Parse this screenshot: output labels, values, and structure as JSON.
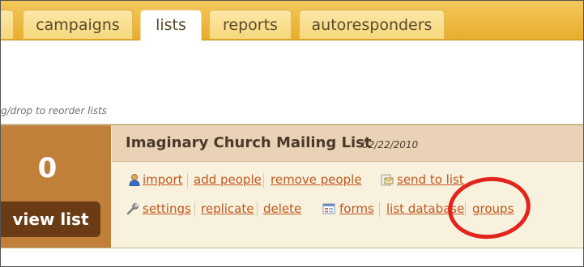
{
  "tabs": [
    {
      "label": "campaigns"
    },
    {
      "label": "lists"
    },
    {
      "label": "reports"
    },
    {
      "label": "autoresponders"
    }
  ],
  "hint": "g/drop to reorder lists",
  "list": {
    "count": "0",
    "view_label": "view list",
    "title": "Imaginary Church Mailing List",
    "date": "02/22/2010",
    "actions_row1": {
      "import": "import",
      "add_people": "add people",
      "remove_people": "remove people",
      "send_to_list": "send to list"
    },
    "actions_row2": {
      "settings": "settings",
      "replicate": "replicate",
      "delete": "delete",
      "forms": "forms",
      "list_database": "list database",
      "groups": "groups"
    }
  },
  "colors": {
    "tab_bar": "#e8ad2c",
    "link": "#c1581d",
    "count_box": "#c1803a",
    "view_button": "#6a3c16",
    "highlight_circle": "#e2241c"
  }
}
